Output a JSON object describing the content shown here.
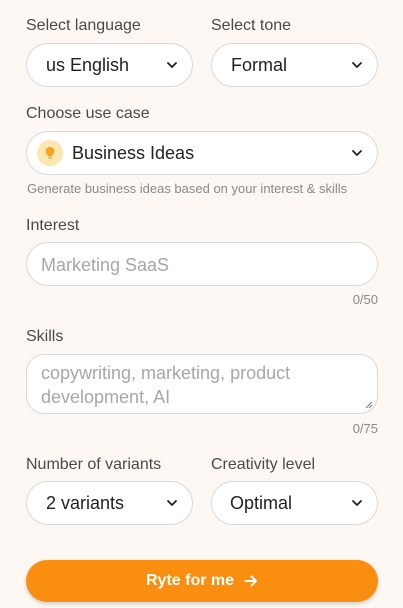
{
  "language": {
    "label": "Select language",
    "value": "us English"
  },
  "tone": {
    "label": "Select tone",
    "value": "Formal"
  },
  "use_case": {
    "label": "Choose use case",
    "value": "Business Ideas",
    "icon": "lightbulb-icon",
    "hint": "Generate business ideas based on your interest & skills"
  },
  "interest": {
    "label": "Interest",
    "placeholder": "Marketing SaaS",
    "counter": "0/50"
  },
  "skills": {
    "label": "Skills",
    "placeholder": "copywriting, marketing, product development, AI",
    "counter": "0/75"
  },
  "variants": {
    "label": "Number of variants",
    "value": "2 variants"
  },
  "creativity": {
    "label": "Creativity level",
    "value": "Optimal"
  },
  "submit": {
    "label": "Ryte for me"
  },
  "colors": {
    "accent": "#fa8e10",
    "background": "#fdf8f3",
    "bulb_bg": "#fde7b0"
  }
}
